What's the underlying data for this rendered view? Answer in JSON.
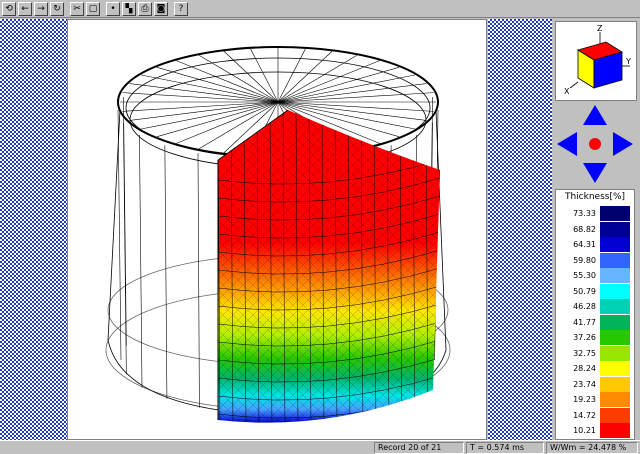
{
  "toolbar": {
    "buttons": [
      {
        "icon": "rotate-icon",
        "glyph": "⟲"
      },
      {
        "icon": "arrow-left-icon",
        "glyph": "←"
      },
      {
        "icon": "arrow-right-icon",
        "glyph": "→"
      },
      {
        "icon": "refresh-icon",
        "glyph": "↻"
      },
      {
        "icon": "cut-icon",
        "glyph": "✂"
      },
      {
        "icon": "frame-icon",
        "glyph": "▢"
      },
      {
        "icon": "pointer-icon",
        "glyph": "•"
      },
      {
        "icon": "palette-icon",
        "glyph": "▚"
      },
      {
        "icon": "print-icon",
        "glyph": "⎙"
      },
      {
        "icon": "camera-icon",
        "glyph": "◙"
      },
      {
        "icon": "help-icon",
        "glyph": "?"
      }
    ]
  },
  "axes": {
    "z": "Z",
    "y": "Y",
    "x": "X"
  },
  "legend": {
    "title": "Thickness[%]",
    "values": [
      "73.33",
      "68.82",
      "64.31",
      "59.80",
      "55.30",
      "50.79",
      "46.28",
      "41.77",
      "37.26",
      "32.75",
      "28.24",
      "23.74",
      "19.23",
      "14.72",
      "10.21"
    ],
    "colors": [
      "#00006e",
      "#000096",
      "#0000d2",
      "#3264ff",
      "#64b4ff",
      "#00ffff",
      "#00d2b4",
      "#00b45a",
      "#28c800",
      "#96e600",
      "#ffff00",
      "#ffc800",
      "#ff8c00",
      "#ff3c00",
      "#ff0000"
    ]
  },
  "status": {
    "record": "Record 20 of 21",
    "time": "T = 0.574 ms",
    "wmm": "W/Wm = 24.478 %"
  },
  "colors": {
    "checker": "#1e3cc8",
    "ui": "#c0c0c0"
  }
}
